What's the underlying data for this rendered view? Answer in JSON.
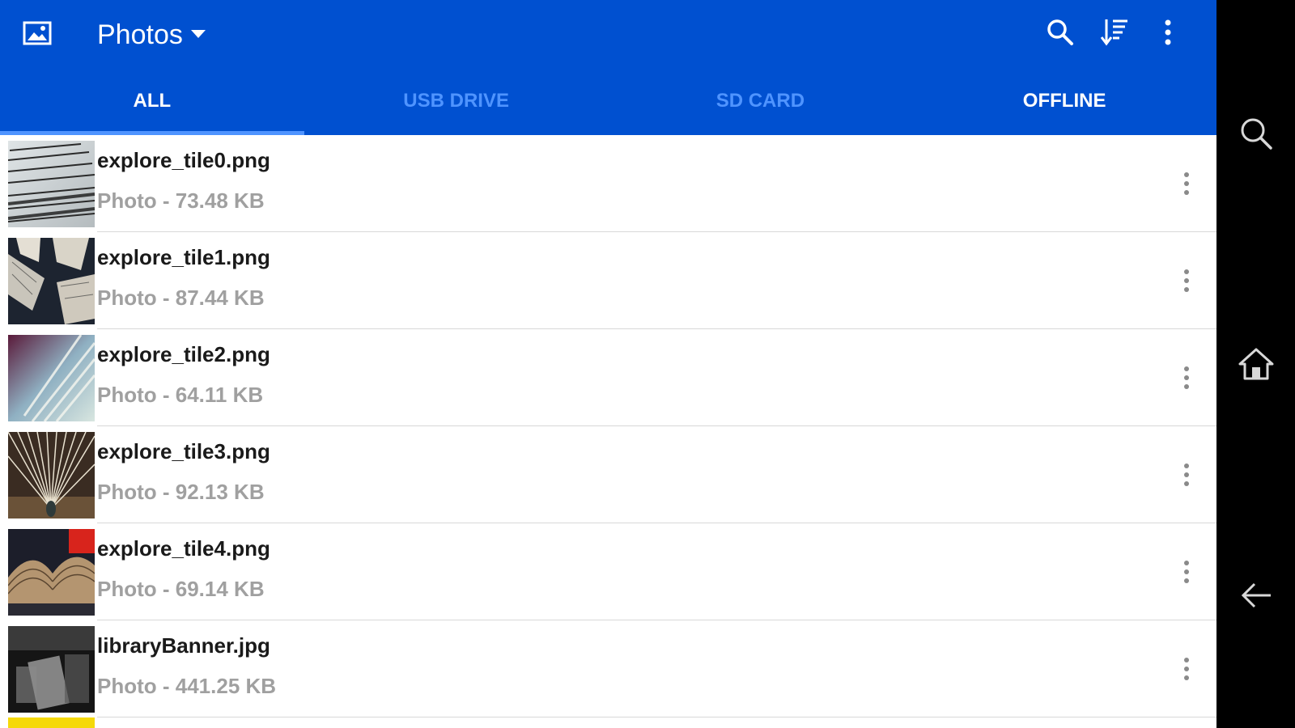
{
  "header": {
    "title": "Photos",
    "app_icon": "image-icon",
    "actions": [
      "search-icon",
      "sort-icon",
      "more-vert-icon"
    ]
  },
  "tabs": [
    {
      "label": "ALL",
      "state": "active"
    },
    {
      "label": "USB DRIVE",
      "state": "inactive"
    },
    {
      "label": "SD CARD",
      "state": "inactive"
    },
    {
      "label": "OFFLINE",
      "state": "inactive"
    }
  ],
  "files": [
    {
      "name": "explore_tile0.png",
      "meta": "Photo - 73.48 KB"
    },
    {
      "name": "explore_tile1.png",
      "meta": "Photo - 87.44 KB"
    },
    {
      "name": "explore_tile2.png",
      "meta": "Photo - 64.11 KB"
    },
    {
      "name": "explore_tile3.png",
      "meta": "Photo - 92.13 KB"
    },
    {
      "name": "explore_tile4.png",
      "meta": "Photo - 69.14 KB"
    },
    {
      "name": "libraryBanner.jpg",
      "meta": "Photo - 441.25 KB"
    }
  ],
  "navbar": [
    "search-icon",
    "home-icon",
    "back-arrow-icon"
  ],
  "colors": {
    "primary": "#0050d0",
    "tab_inactive": "#4f94ff",
    "secondary_text": "#a0a0a0",
    "divider": "#d8d8d8"
  }
}
